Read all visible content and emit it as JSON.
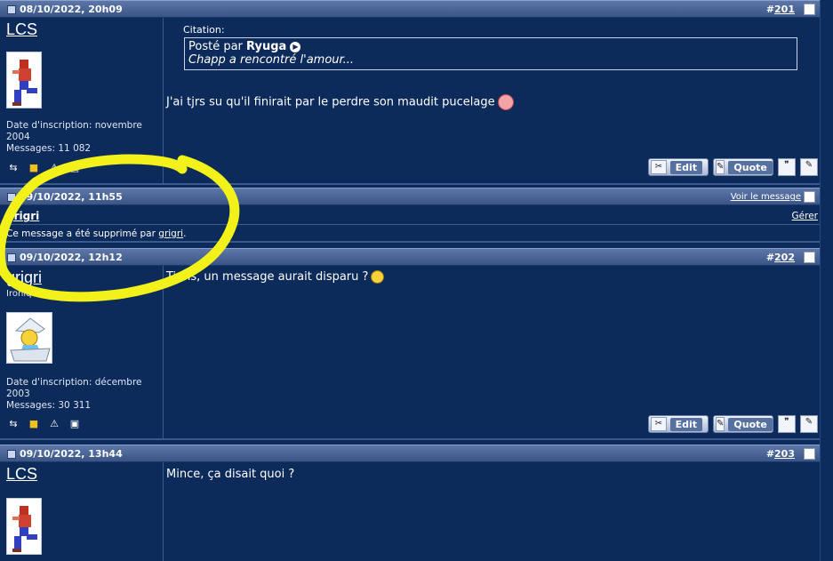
{
  "posts": [
    {
      "date": "08/10/2022, 20h09",
      "number_prefix": "#",
      "number": "201",
      "username": "LCS",
      "join": "Date d'inscription: novembre 2004",
      "messages": "Messages: 11 082",
      "quote": {
        "label": "Citation:",
        "posted_by_prefix": "Posté par",
        "author": "Ryuga",
        "text": "Chapp a rencontré l'amour..."
      },
      "text": "J'ai tjrs su qu'il finirait par le perdre son maudit pucelage"
    },
    {
      "date": "09/10/2022, 11h55",
      "view_link": "Voir le message",
      "username": "grigri",
      "manage": "Gérer",
      "deleted_prefix": "Ce message a été supprimé par",
      "deleted_by": "grigri",
      "deleted_suffix": "."
    },
    {
      "date": "09/10/2022, 12h12",
      "number_prefix": "#",
      "number": "202",
      "username": "grigri",
      "title": "Ironique",
      "join": "Date d'inscription: décembre 2003",
      "messages": "Messages: 30 311",
      "text": "Tiens, un message aurait disparu ?"
    },
    {
      "date": "09/10/2022, 13h44",
      "number_prefix": "#",
      "number": "203",
      "username": "LCS",
      "text": "Mince, ça disait quoi ?"
    }
  ],
  "buttons": {
    "edit": "Edit",
    "quote": "Quote"
  },
  "colors": {
    "background": "#0c2a5a",
    "header": "#3a5585",
    "highlight": "#f2f21a"
  },
  "icons": [
    "post-icon",
    "profile-icon",
    "warn-card-icon",
    "report-icon",
    "pc-icon",
    "multiquote-icon",
    "reply-icon"
  ]
}
